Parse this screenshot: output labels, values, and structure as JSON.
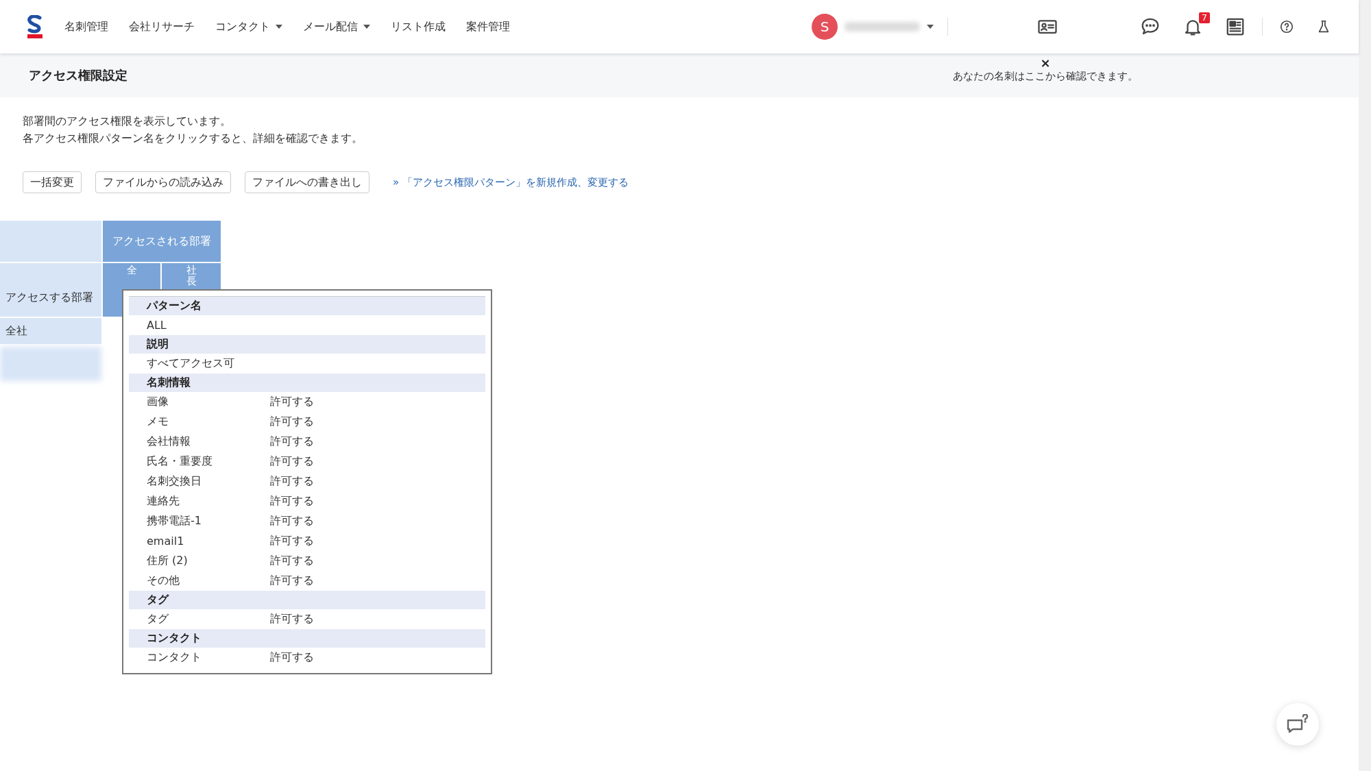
{
  "nav": {
    "items": [
      {
        "label": "名刺管理",
        "dropdown": false
      },
      {
        "label": "会社リサーチ",
        "dropdown": false
      },
      {
        "label": "コンタクト",
        "dropdown": true
      },
      {
        "label": "メール配信",
        "dropdown": true
      },
      {
        "label": "リスト作成",
        "dropdown": false
      },
      {
        "label": "案件管理",
        "dropdown": false
      }
    ],
    "user_initial": "S",
    "notification_count": "7"
  },
  "page": {
    "title": "アクセス権限設定",
    "toast": {
      "close": "×",
      "message": "あなたの名刺はここから確認できます。"
    }
  },
  "intro": [
    "部署間のアクセス権限を表示しています。",
    "各アクセス権限パターン名をクリックすると、詳細を確認できます。"
  ],
  "buttons": [
    "一括変更",
    "ファイルからの読み込み",
    "ファイルへの書き出し"
  ],
  "link": "» 「アクセス権限パターン」を新規作成、変更する",
  "matrix": {
    "accessed_header": "アクセスされる部署",
    "accessing_header": "アクセスする部署",
    "columns": [
      "全",
      "社長"
    ],
    "rows": [
      "全社"
    ]
  },
  "popup": {
    "sections": [
      {
        "title": "パターン名",
        "items": [
          {
            "label": "ALL"
          }
        ]
      },
      {
        "title": "説明",
        "items": [
          {
            "label": "すべてアクセス可"
          }
        ]
      },
      {
        "title": "名刺情報",
        "items": [
          {
            "label": "画像",
            "value": "許可する"
          },
          {
            "label": "メモ",
            "value": "許可する"
          },
          {
            "label": "会社情報",
            "value": "許可する"
          },
          {
            "label": "氏名・重要度",
            "value": "許可する"
          },
          {
            "label": "名刺交換日",
            "value": "許可する"
          },
          {
            "label": "連絡先",
            "value": "許可する"
          },
          {
            "label": "携帯電話-1",
            "value": "許可する"
          },
          {
            "label": "email1",
            "value": "許可する"
          },
          {
            "label": "住所 (2)",
            "value": "許可する"
          },
          {
            "label": "その他",
            "value": "許可する"
          }
        ]
      },
      {
        "title": "タグ",
        "items": [
          {
            "label": "タグ",
            "value": "許可する"
          }
        ]
      },
      {
        "title": "コンタクト",
        "items": [
          {
            "label": "コンタクト",
            "value": "許可する"
          }
        ]
      }
    ]
  }
}
